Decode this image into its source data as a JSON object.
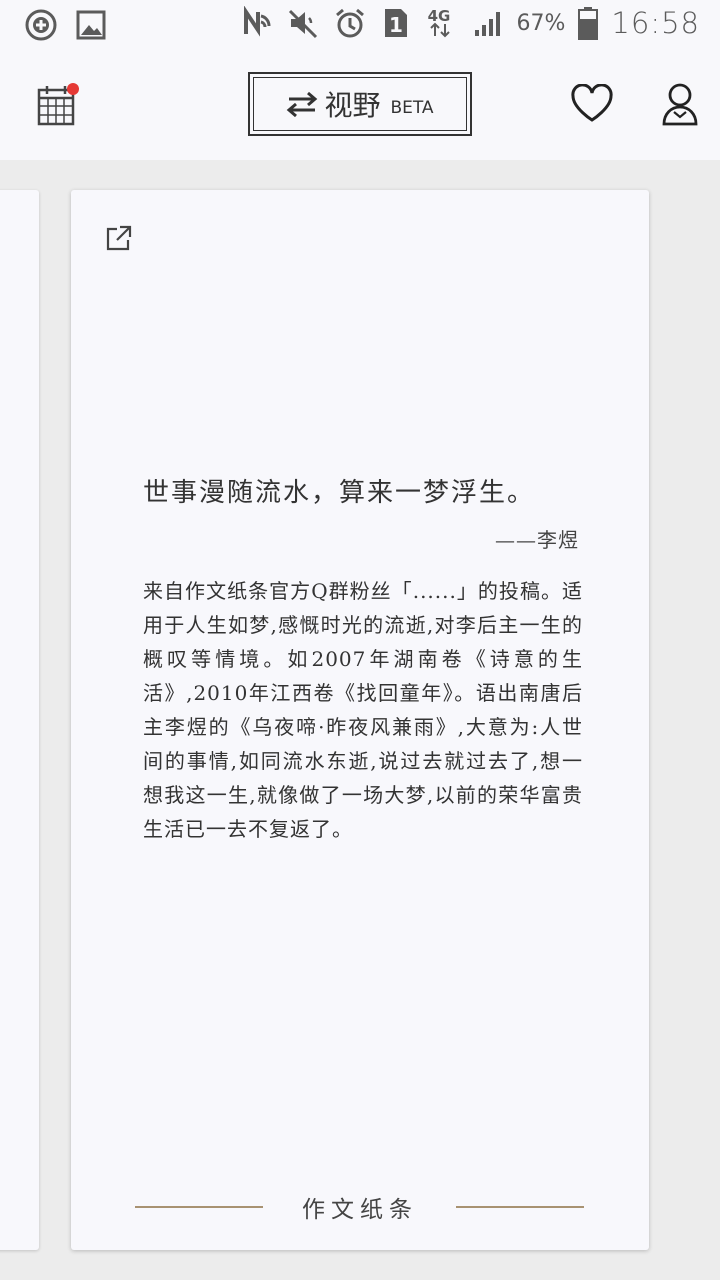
{
  "status_bar": {
    "left_icons": [
      "add-circle-icon",
      "image-icon"
    ],
    "right_icons": [
      "nfc-icon",
      "mute-icon",
      "alarm-icon",
      "sim-1-icon",
      "network-4g-icon",
      "signal-icon",
      "battery-icon"
    ],
    "network_label": "4G",
    "sim_label": "1",
    "battery_percent": "67%",
    "time": "16:58"
  },
  "app_bar": {
    "view_toggle_label": "视野",
    "view_toggle_badge": "BETA",
    "calendar_has_notification": true,
    "notification_color": "#e53935"
  },
  "card": {
    "quote": "世事漫随流水，算来一梦浮生。",
    "author": "——李煜",
    "description": "来自作文纸条官方Q群粉丝「......」的投稿。适用于人生如梦,感慨时光的流逝,对李后主一生的概叹等情境。如2007年湖南卷《诗意的生活》,2010年江西卷《找回童年》。语出南唐后主李煜的《乌夜啼·昨夜风兼雨》,大意为:人世间的事情,如同流水东逝,说过去就过去了,想一想我这一生,就像做了一场大梦,以前的荣华富贵生活已一去不复返了。",
    "footer_brand": "作文纸条",
    "accent_color": "#a89272"
  }
}
